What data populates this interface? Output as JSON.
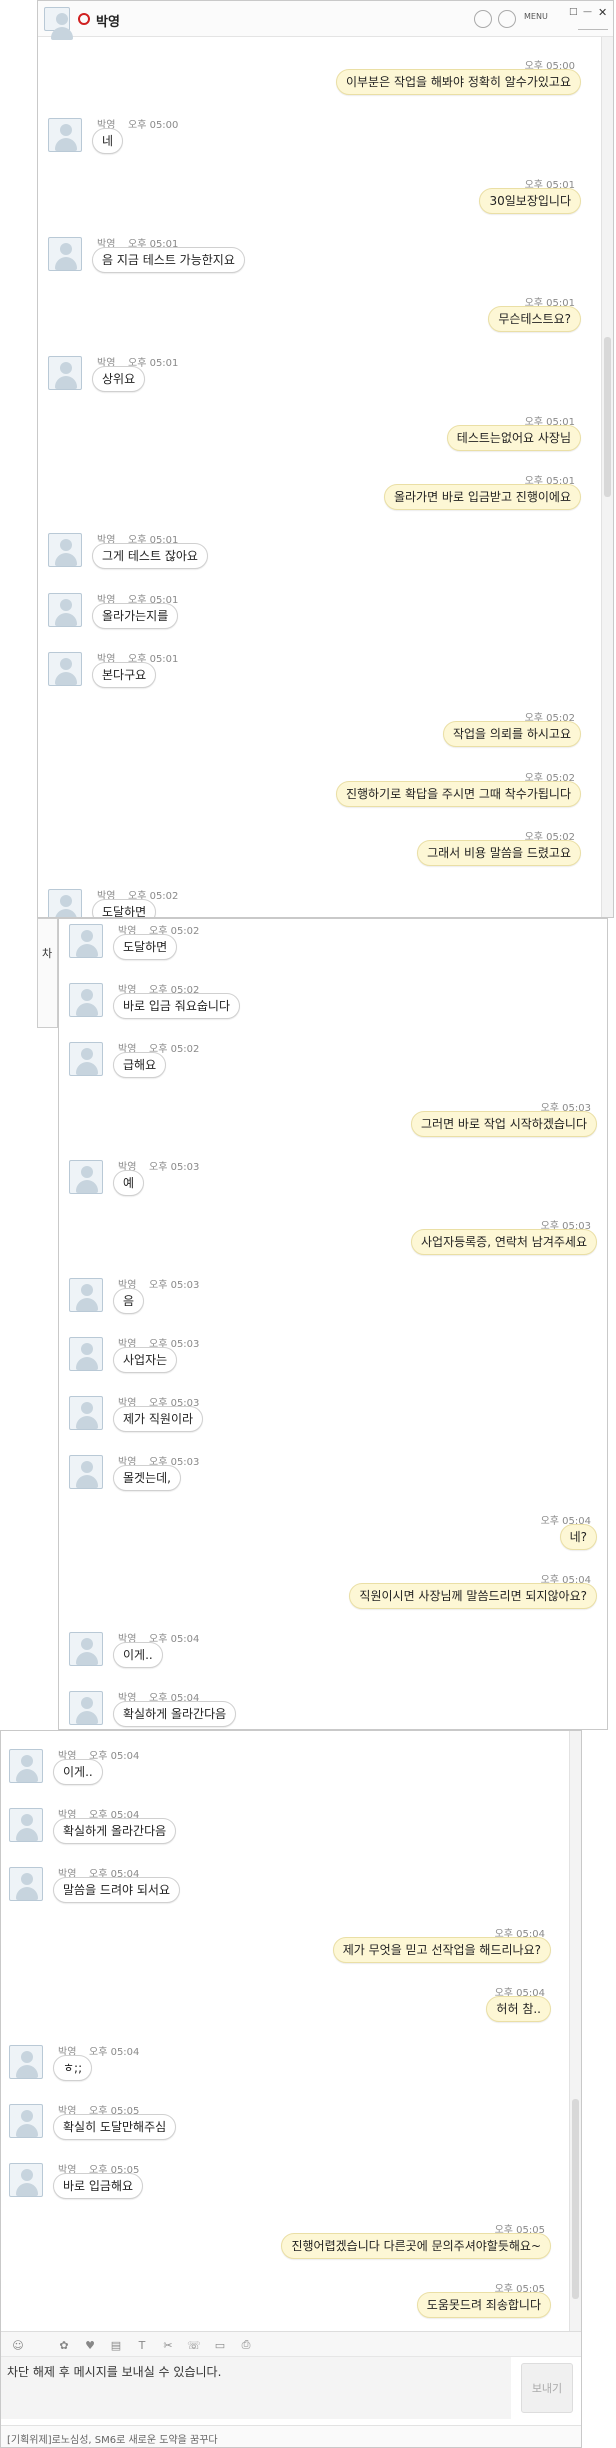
{
  "window1": {
    "title": "박영",
    "menu_label": "MENU",
    "window_controls": [
      "□",
      "—",
      "✕"
    ],
    "messages": [
      {
        "side": "r",
        "time": "오후 05:00",
        "text": "이부분은 작업을 해봐야 정확히 알수가있고요"
      },
      {
        "side": "l",
        "name": "박영",
        "time": "오후 05:00",
        "text": "네"
      },
      {
        "side": "r",
        "time": "오후 05:01",
        "text": "30일보장입니다"
      },
      {
        "side": "l",
        "name": "박영",
        "time": "오후 05:01",
        "text": "음 지금 테스트 가능한지요"
      },
      {
        "side": "r",
        "time": "오후 05:01",
        "text": "무슨테스트요?"
      },
      {
        "side": "l",
        "name": "박영",
        "time": "오후 05:01",
        "text": "상위요"
      },
      {
        "side": "r",
        "time": "오후 05:01",
        "text": "테스트는없어요 사장님"
      },
      {
        "side": "r",
        "time": "오후 05:01",
        "text": "올라가면 바로 입금받고 진행이에요"
      },
      {
        "side": "l",
        "name": "박영",
        "time": "오후 05:01",
        "text": "그게 테스트 잖아요"
      },
      {
        "side": "l",
        "name": "박영",
        "time": "오후 05:01",
        "text": "올라가는지를"
      },
      {
        "side": "l",
        "name": "박영",
        "time": "오후 05:01",
        "text": "본다구요"
      },
      {
        "side": "r",
        "time": "오후 05:02",
        "text": "작업을 의뢰를 하시고요"
      },
      {
        "side": "r",
        "time": "오후 05:02",
        "text": "진행하기로 확답을 주시면 그때 착수가됩니다"
      },
      {
        "side": "r",
        "time": "오후 05:02",
        "text": "그래서 비용 말씀을 드렸고요"
      },
      {
        "side": "l",
        "name": "박영",
        "time": "오후 05:02",
        "text": "도달하면"
      }
    ],
    "peek_left": [
      "차"
    ]
  },
  "window2": {
    "messages": [
      {
        "side": "l",
        "name": "박영",
        "time": "오후 05:02",
        "text": "도달하면"
      },
      {
        "side": "l",
        "name": "박영",
        "time": "오후 05:02",
        "text": "바로 입금 줘요숩니다"
      },
      {
        "side": "l",
        "name": "박영",
        "time": "오후 05:02",
        "text": "급해요"
      },
      {
        "side": "r",
        "time": "오후 05:03",
        "text": "그러면 바로 작업 시작하겠습니다"
      },
      {
        "side": "l",
        "name": "박영",
        "time": "오후 05:03",
        "text": "예"
      },
      {
        "side": "r",
        "time": "오후 05:03",
        "text": "사업자등록증, 연락처 남겨주세요"
      },
      {
        "side": "l",
        "name": "박영",
        "time": "오후 05:03",
        "text": "음"
      },
      {
        "side": "l",
        "name": "박영",
        "time": "오후 05:03",
        "text": "사업자는"
      },
      {
        "side": "l",
        "name": "박영",
        "time": "오후 05:03",
        "text": "제가 직원이라"
      },
      {
        "side": "l",
        "name": "박영",
        "time": "오후 05:03",
        "text": "몰겟는데,"
      },
      {
        "side": "r",
        "time": "오후 05:04",
        "text": "네?"
      },
      {
        "side": "r",
        "time": "오후 05:04",
        "text": "직원이시면 사장님께 말씀드리면 되지않아요?"
      },
      {
        "side": "l",
        "name": "박영",
        "time": "오후 05:04",
        "text": "이게.."
      },
      {
        "side": "l",
        "name": "박영",
        "time": "오후 05:04",
        "text": "확실하게 올라간다음"
      }
    ]
  },
  "window3": {
    "messages": [
      {
        "side": "l",
        "name": "박영",
        "time": "오후 05:04",
        "text": "이게.."
      },
      {
        "side": "l",
        "name": "박영",
        "time": "오후 05:04",
        "text": "확실하게 올라간다음"
      },
      {
        "side": "l",
        "name": "박영",
        "time": "오후 05:04",
        "text": "말씀을 드려야 되서요"
      },
      {
        "side": "r",
        "time": "오후 05:04",
        "text": "제가 무엇을 믿고 선작업을 해드리나요?"
      },
      {
        "side": "r",
        "time": "오후 05:04",
        "text": "허허 참.."
      },
      {
        "side": "l",
        "name": "박영",
        "time": "오후 05:04",
        "text": "ㅎ;;"
      },
      {
        "side": "l",
        "name": "박영",
        "time": "오후 05:05",
        "text": "확실히 도달만해주심"
      },
      {
        "side": "l",
        "name": "박영",
        "time": "오후 05:05",
        "text": "바로 입금해요"
      },
      {
        "side": "r",
        "time": "오후 05:05",
        "text": "진행어렵겠습니다 다른곳에 문의주셔야할듯해요~"
      },
      {
        "side": "r",
        "time": "오후 05:05",
        "text": "도움못드려 죄송합니다"
      }
    ],
    "toolbar_icons": [
      "emoticon-icon",
      "sticker-icon",
      "gift-icon",
      "file-icon",
      "font-icon",
      "capture-icon",
      "call-icon",
      "screen-share-icon",
      "print-icon"
    ],
    "input_text": "차단 해제 후 메시지를 보내실 수 있습니다.",
    "send_label": "보내기",
    "status_text": "[기획위제]로노심성, SM6로 새로운 도약을 꿈꾸다"
  },
  "colors": {
    "my_bubble": "#fdf7d5",
    "their_bubble": "#ffffff"
  }
}
